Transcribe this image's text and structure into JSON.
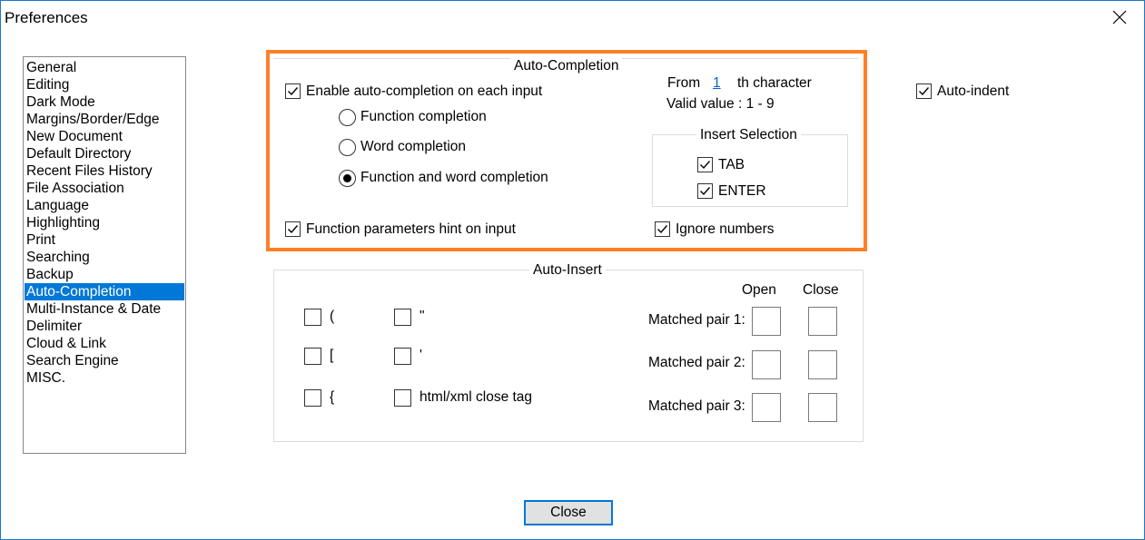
{
  "window": {
    "title": "Preferences"
  },
  "categories": [
    "General",
    "Editing",
    "Dark Mode",
    "Margins/Border/Edge",
    "New Document",
    "Default Directory",
    "Recent Files History",
    "File Association",
    "Language",
    "Highlighting",
    "Print",
    "Searching",
    "Backup",
    "Auto-Completion",
    "Multi-Instance & Date",
    "Delimiter",
    "Cloud & Link",
    "Search Engine",
    "MISC."
  ],
  "selected_category": "Auto-Completion",
  "auto_completion": {
    "group_title": "Auto-Completion",
    "enable_label": "Enable auto-completion on each input",
    "enable_checked": true,
    "radio_function": "Function completion",
    "radio_word": "Word completion",
    "radio_both": "Function and word completion",
    "selected_radio": "Function and word completion",
    "from_label": "From",
    "from_value": "1",
    "th_label": "th character",
    "valid_label": "Valid value : 1 - 9",
    "insert_selection_title": "Insert Selection",
    "tab_label": "TAB",
    "tab_checked": true,
    "enter_label": "ENTER",
    "enter_checked": true,
    "param_hint_label": "Function parameters hint on input",
    "param_hint_checked": true,
    "ignore_numbers_label": "Ignore numbers",
    "ignore_numbers_checked": true
  },
  "auto_indent": {
    "label": "Auto-indent",
    "checked": true
  },
  "auto_insert": {
    "group_title": "Auto-Insert",
    "paren_label": "(",
    "bracket_label": "[",
    "brace_label": "{",
    "dquote_label": "\"",
    "squote_label": "'",
    "html_label": "html/xml close tag",
    "open_header": "Open",
    "close_header": "Close",
    "pair1_label": "Matched pair 1:",
    "pair2_label": "Matched pair 2:",
    "pair3_label": "Matched pair 3:"
  },
  "close_button": "Close"
}
